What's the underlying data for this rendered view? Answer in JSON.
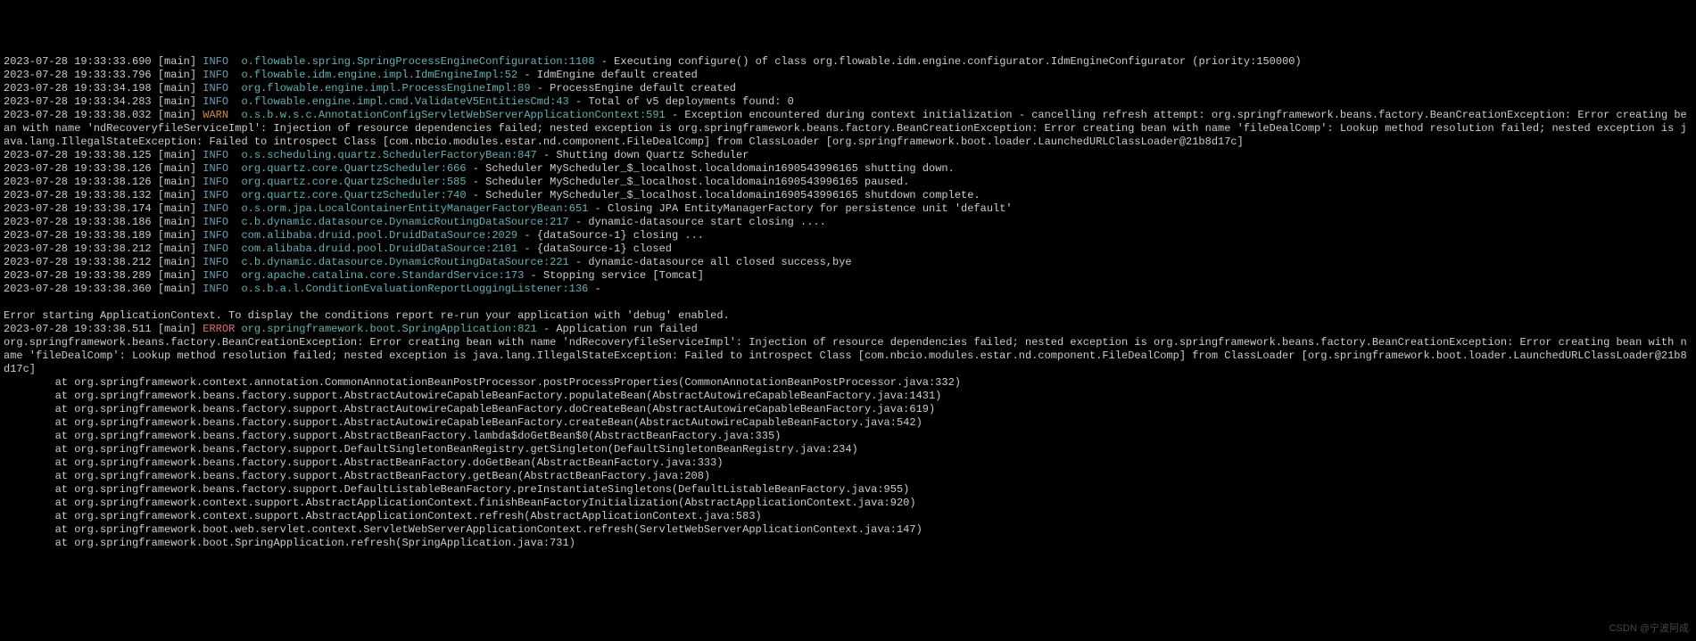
{
  "watermark": "CSDN @宁波阿成",
  "lines": [
    {
      "ts": "2023-07-28 19:33:33.690",
      "thread": "[main]",
      "level": "INFO",
      "logger": "o.flowable.spring.SpringProcessEngineConfiguration:1108",
      "msg": " - Executing configure() of class org.flowable.idm.engine.configurator.IdmEngineConfigurator (priority:150000)"
    },
    {
      "ts": "2023-07-28 19:33:33.796",
      "thread": "[main]",
      "level": "INFO",
      "logger": "o.flowable.idm.engine.impl.IdmEngineImpl:52",
      "msg": " - IdmEngine default created"
    },
    {
      "ts": "2023-07-28 19:33:34.198",
      "thread": "[main]",
      "level": "INFO",
      "logger": "org.flowable.engine.impl.ProcessEngineImpl:89",
      "msg": " - ProcessEngine default created"
    },
    {
      "ts": "2023-07-28 19:33:34.283",
      "thread": "[main]",
      "level": "INFO",
      "logger": "o.flowable.engine.impl.cmd.ValidateV5EntitiesCmd:43",
      "msg": " - Total of v5 deployments found: 0"
    },
    {
      "ts": "2023-07-28 19:33:38.032",
      "thread": "[main]",
      "level": "WARN",
      "logger": "o.s.b.w.s.c.AnnotationConfigServletWebServerApplicationContext:591",
      "msg": " - Exception encountered during context initialization - cancelling refresh attempt: org.springframework.beans.factory.BeanCreationException: Error creating bean with name 'ndRecoveryfileServiceImpl': Injection of resource dependencies failed; nested exception is org.springframework.beans.factory.BeanCreationException: Error creating bean with name 'fileDealComp': Lookup method resolution failed; nested exception is java.lang.IllegalStateException: Failed to introspect Class [com.nbcio.modules.estar.nd.component.FileDealComp] from ClassLoader [org.springframework.boot.loader.LaunchedURLClassLoader@21b8d17c]"
    },
    {
      "ts": "2023-07-28 19:33:38.125",
      "thread": "[main]",
      "level": "INFO",
      "logger": "o.s.scheduling.quartz.SchedulerFactoryBean:847",
      "msg": " - Shutting down Quartz Scheduler"
    },
    {
      "ts": "2023-07-28 19:33:38.126",
      "thread": "[main]",
      "level": "INFO",
      "logger": "org.quartz.core.QuartzScheduler:666",
      "msg": " - Scheduler MyScheduler_$_localhost.localdomain1690543996165 shutting down."
    },
    {
      "ts": "2023-07-28 19:33:38.126",
      "thread": "[main]",
      "level": "INFO",
      "logger": "org.quartz.core.QuartzScheduler:585",
      "msg": " - Scheduler MyScheduler_$_localhost.localdomain1690543996165 paused."
    },
    {
      "ts": "2023-07-28 19:33:38.132",
      "thread": "[main]",
      "level": "INFO",
      "logger": "org.quartz.core.QuartzScheduler:740",
      "msg": " - Scheduler MyScheduler_$_localhost.localdomain1690543996165 shutdown complete."
    },
    {
      "ts": "2023-07-28 19:33:38.174",
      "thread": "[main]",
      "level": "INFO",
      "logger": "o.s.orm.jpa.LocalContainerEntityManagerFactoryBean:651",
      "msg": " - Closing JPA EntityManagerFactory for persistence unit 'default'"
    },
    {
      "ts": "2023-07-28 19:33:38.186",
      "thread": "[main]",
      "level": "INFO",
      "logger": "c.b.dynamic.datasource.DynamicRoutingDataSource:217",
      "msg": " - dynamic-datasource start closing ...."
    },
    {
      "ts": "2023-07-28 19:33:38.189",
      "thread": "[main]",
      "level": "INFO",
      "logger": "com.alibaba.druid.pool.DruidDataSource:2029",
      "msg": " - {dataSource-1} closing ..."
    },
    {
      "ts": "2023-07-28 19:33:38.212",
      "thread": "[main]",
      "level": "INFO",
      "logger": "com.alibaba.druid.pool.DruidDataSource:2101",
      "msg": " - {dataSource-1} closed"
    },
    {
      "ts": "2023-07-28 19:33:38.212",
      "thread": "[main]",
      "level": "INFO",
      "logger": "c.b.dynamic.datasource.DynamicRoutingDataSource:221",
      "msg": " - dynamic-datasource all closed success,bye"
    },
    {
      "ts": "2023-07-28 19:33:38.289",
      "thread": "[main]",
      "level": "INFO",
      "logger": "org.apache.catalina.core.StandardService:173",
      "msg": " - Stopping service [Tomcat]"
    },
    {
      "ts": "2023-07-28 19:33:38.360",
      "thread": "[main]",
      "level": "INFO",
      "logger": "o.s.b.a.l.ConditionEvaluationReportLoggingListener:136",
      "msg": " -"
    },
    {
      "blank": true
    },
    {
      "raw": "Error starting ApplicationContext. To display the conditions report re-run your application with 'debug' enabled."
    },
    {
      "ts": "2023-07-28 19:33:38.511",
      "thread": "[main]",
      "level": "ERROR",
      "logger": "org.springframework.boot.SpringApplication:821",
      "msg": " - Application run failed"
    },
    {
      "raw": "org.springframework.beans.factory.BeanCreationException: Error creating bean with name 'ndRecoveryfileServiceImpl': Injection of resource dependencies failed; nested exception is org.springframework.beans.factory.BeanCreationException: Error creating bean with name 'fileDealComp': Lookup method resolution failed; nested exception is java.lang.IllegalStateException: Failed to introspect Class [com.nbcio.modules.estar.nd.component.FileDealComp] from ClassLoader [org.springframework.boot.loader.LaunchedURLClassLoader@21b8d17c]"
    },
    {
      "raw": "        at org.springframework.context.annotation.CommonAnnotationBeanPostProcessor.postProcessProperties(CommonAnnotationBeanPostProcessor.java:332)"
    },
    {
      "raw": "        at org.springframework.beans.factory.support.AbstractAutowireCapableBeanFactory.populateBean(AbstractAutowireCapableBeanFactory.java:1431)"
    },
    {
      "raw": "        at org.springframework.beans.factory.support.AbstractAutowireCapableBeanFactory.doCreateBean(AbstractAutowireCapableBeanFactory.java:619)"
    },
    {
      "raw": "        at org.springframework.beans.factory.support.AbstractAutowireCapableBeanFactory.createBean(AbstractAutowireCapableBeanFactory.java:542)"
    },
    {
      "raw": "        at org.springframework.beans.factory.support.AbstractBeanFactory.lambda$doGetBean$0(AbstractBeanFactory.java:335)"
    },
    {
      "raw": "        at org.springframework.beans.factory.support.DefaultSingletonBeanRegistry.getSingleton(DefaultSingletonBeanRegistry.java:234)"
    },
    {
      "raw": "        at org.springframework.beans.factory.support.AbstractBeanFactory.doGetBean(AbstractBeanFactory.java:333)"
    },
    {
      "raw": "        at org.springframework.beans.factory.support.AbstractBeanFactory.getBean(AbstractBeanFactory.java:208)"
    },
    {
      "raw": "        at org.springframework.beans.factory.support.DefaultListableBeanFactory.preInstantiateSingletons(DefaultListableBeanFactory.java:955)"
    },
    {
      "raw": "        at org.springframework.context.support.AbstractApplicationContext.finishBeanFactoryInitialization(AbstractApplicationContext.java:920)"
    },
    {
      "raw": "        at org.springframework.context.support.AbstractApplicationContext.refresh(AbstractApplicationContext.java:583)"
    },
    {
      "raw": "        at org.springframework.boot.web.servlet.context.ServletWebServerApplicationContext.refresh(ServletWebServerApplicationContext.java:147)"
    },
    {
      "raw": "        at org.springframework.boot.SpringApplication.refresh(SpringApplication.java:731)"
    }
  ]
}
